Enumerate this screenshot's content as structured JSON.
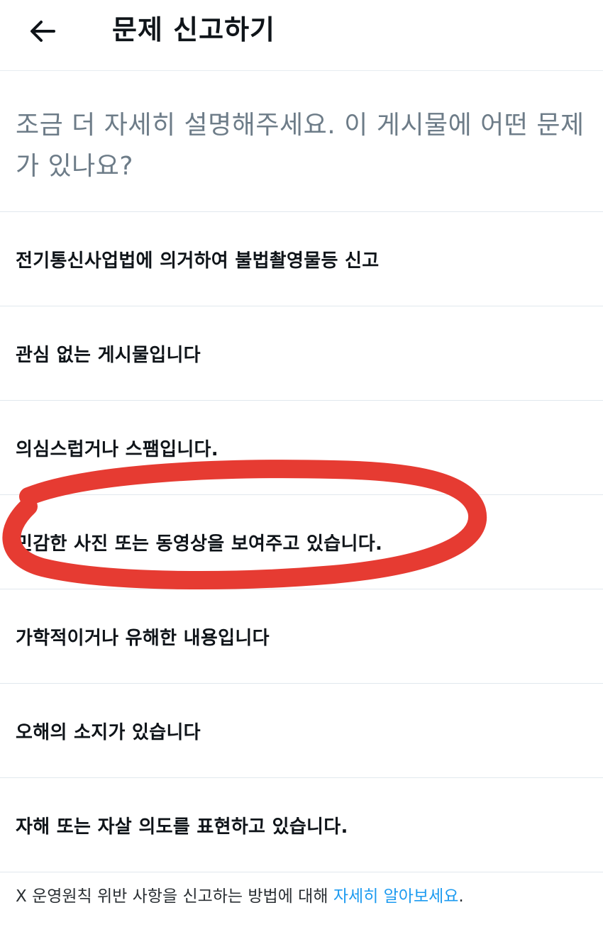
{
  "header": {
    "back_icon": "arrow-left-icon",
    "title": "문제 신고하기"
  },
  "prompt": {
    "text": "조금 더 자세히 설명해주세요. 이 게시물에 어떤 문제가 있나요?"
  },
  "options": [
    {
      "label": "전기통신사업법에 의거하여 불법촬영물등 신고"
    },
    {
      "label": "관심 없는 게시물입니다"
    },
    {
      "label": "의심스럽거나 스팸입니다."
    },
    {
      "label": "민감한 사진 또는 동영상을 보여주고 있습니다."
    },
    {
      "label": "가학적이거나 유해한 내용입니다"
    },
    {
      "label": "오해의 소지가 있습니다"
    },
    {
      "label": "자해 또는 자살 의도를 표현하고 있습니다."
    }
  ],
  "footer": {
    "text": "X 운영원칙 위반 사항을 신고하는 방법에 대해 ",
    "link_text": "자세히 알아보세요",
    "end_text": "."
  },
  "colors": {
    "annotation": "#e63b32",
    "link": "#1d9bf0",
    "muted_text": "#6d7c88"
  }
}
